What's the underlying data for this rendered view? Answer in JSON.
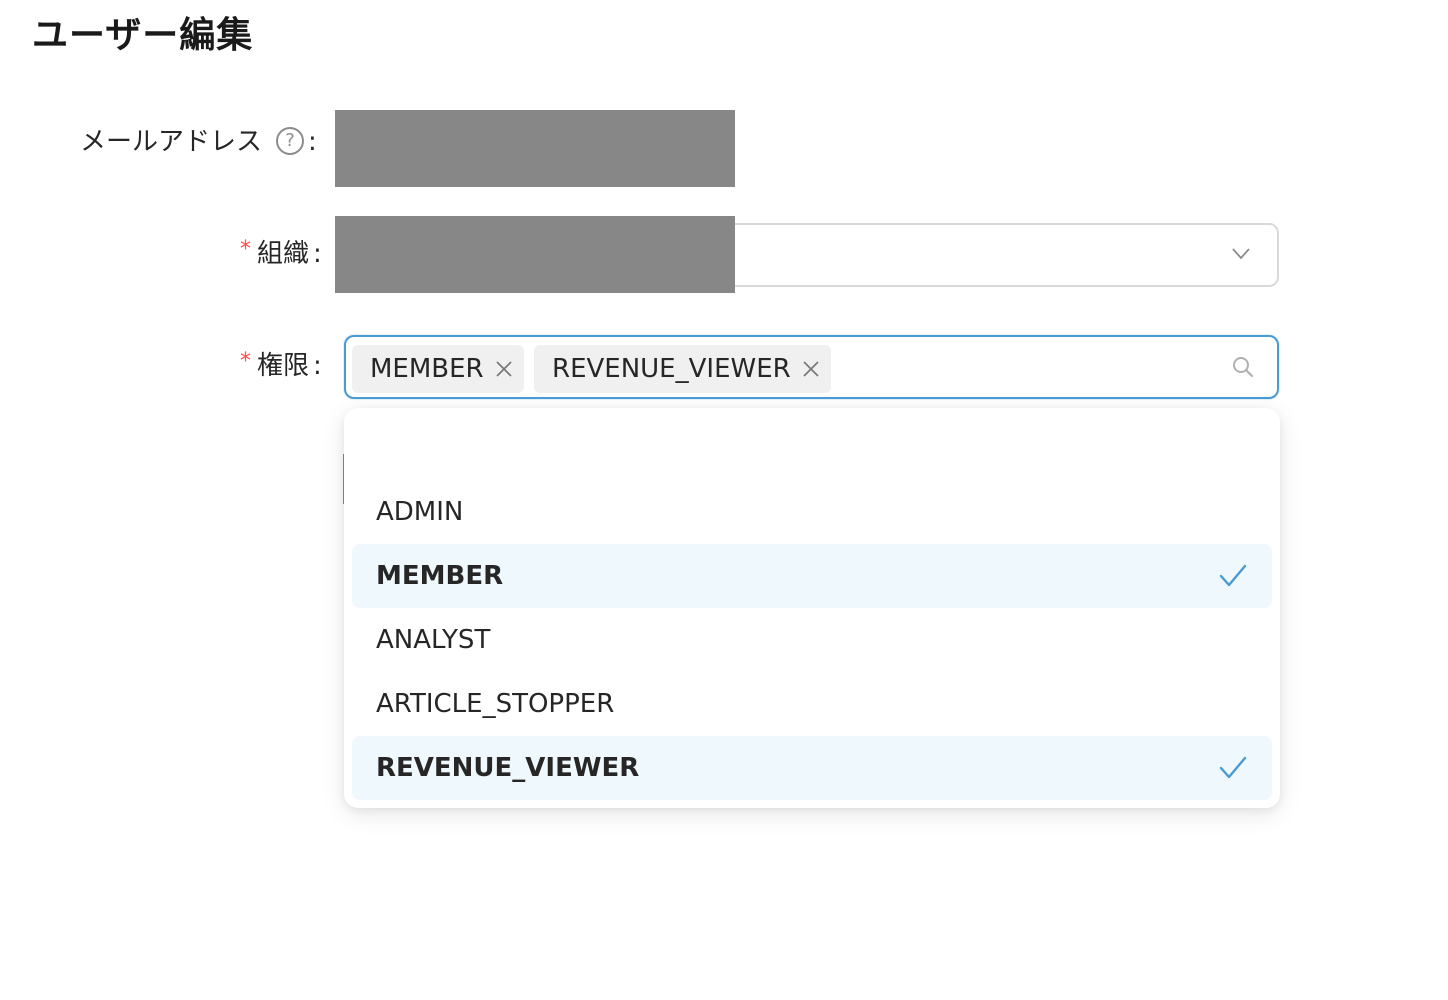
{
  "page": {
    "title": "ユーザー編集"
  },
  "form": {
    "email": {
      "label": "メールアドレス",
      "colon": ":"
    },
    "organization": {
      "label": "組織",
      "required_mark": "*",
      "colon": ":"
    },
    "permissions": {
      "label": "権限",
      "required_mark": "*",
      "colon": ":",
      "selected_tags": [
        "MEMBER",
        "REVENUE_VIEWER"
      ]
    }
  },
  "dropdown": {
    "options": [
      {
        "label": "ADMIN",
        "selected": false
      },
      {
        "label": "MEMBER",
        "selected": true
      },
      {
        "label": "ANALYST",
        "selected": false
      },
      {
        "label": "ARTICLE_STOPPER",
        "selected": false
      },
      {
        "label": "REVENUE_VIEWER",
        "selected": true
      }
    ]
  },
  "icons": {
    "help": "question-circle-icon",
    "chevron": "chevron-down-icon",
    "tag_close": "close-icon",
    "search": "search-icon",
    "check": "check-icon"
  },
  "colors": {
    "required": "#ff4d4f",
    "accent": "#4a9bd4",
    "selected_option_bg": "#eef8fd",
    "redacted": "#878787"
  }
}
